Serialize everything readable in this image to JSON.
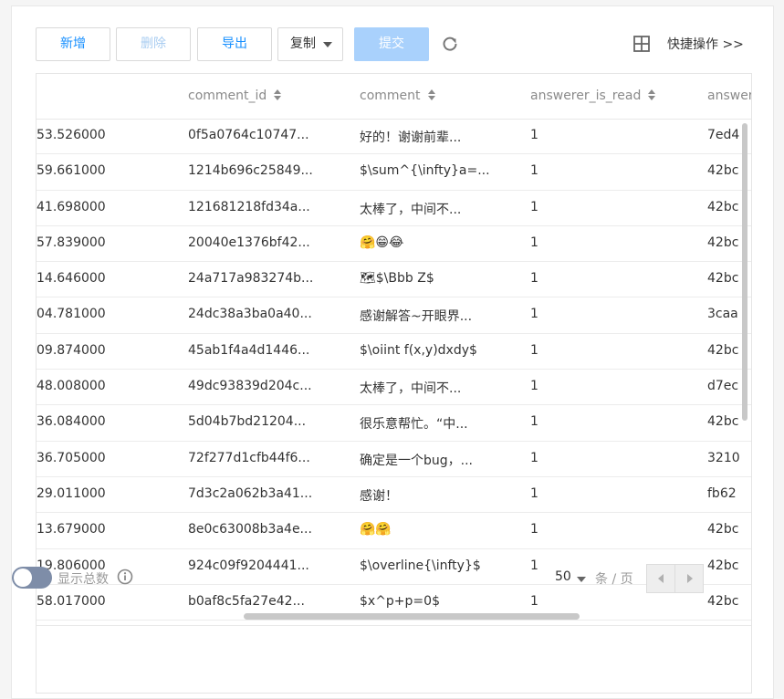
{
  "toolbar": {
    "add_label": "新增",
    "delete_label": "删除",
    "export_label": "导出",
    "copy_label": "复制",
    "submit_label": "提交",
    "quick_actions_label": "快捷操作 >>"
  },
  "table": {
    "columns": [
      {
        "label": ""
      },
      {
        "label": "comment_id"
      },
      {
        "label": "comment"
      },
      {
        "label": "answerer_is_read"
      },
      {
        "label": "answer"
      }
    ],
    "rows": [
      [
        "53.526000",
        "0f5a0764c10747...",
        "好的！谢谢前辈...",
        "1",
        "7ed4"
      ],
      [
        "59.661000",
        "1214b696c25849...",
        "$\\sum^{\\infty}a=...",
        "1",
        "42bc"
      ],
      [
        "41.698000",
        "121681218fd34a...",
        "太棒了，中间不...",
        "1",
        "42bc"
      ],
      [
        "57.839000",
        "20040e1376bf42...",
        "🤗😁😂",
        "1",
        "42bc"
      ],
      [
        "14.646000",
        "24a717a983274b...",
        "🗺$\\Bbb Z$",
        "1",
        "42bc"
      ],
      [
        "04.781000",
        "24dc38a3ba0a40...",
        "感谢解答~开眼界...",
        "1",
        "3caa"
      ],
      [
        "09.874000",
        "45ab1f4a4d1446...",
        "$\\oiint f(x,y)dxdy$",
        "1",
        "42bc"
      ],
      [
        "48.008000",
        "49dc93839d204c...",
        "太棒了，中间不...",
        "1",
        "d7ec"
      ],
      [
        "36.084000",
        "5d04b7bd21204...",
        "很乐意帮忙。“中...",
        "1",
        "42bc"
      ],
      [
        "36.705000",
        "72f277d1cfb44f6...",
        "确定是一个bug，...",
        "1",
        "3210"
      ],
      [
        "29.011000",
        "7d3c2a062b3a41...",
        "感谢！",
        "1",
        "fb62"
      ],
      [
        "13.679000",
        "8e0c63008b3a4e...",
        "🤗🤗",
        "1",
        "42bc"
      ],
      [
        "19.806000",
        "924c09f9204441...",
        "$\\overline{\\infty}$",
        "1",
        "42bc"
      ],
      [
        "58.017000",
        "b0af8c5fa27e42...",
        "$x^p+p=0$",
        "1",
        "42bc"
      ]
    ]
  },
  "footer": {
    "show_total_label": "显示总数",
    "show_total_enabled": false,
    "page_size": "50",
    "per_page_label": "条 / 页"
  },
  "colors": {
    "accent": "#1890ff",
    "submit_disabled": "#a9d1fc",
    "toggle_off": "#7e8da8"
  },
  "icons": {
    "refresh": "refresh-icon",
    "grid": "grid-icon",
    "info": "info-icon",
    "sort": "sort-icon"
  }
}
